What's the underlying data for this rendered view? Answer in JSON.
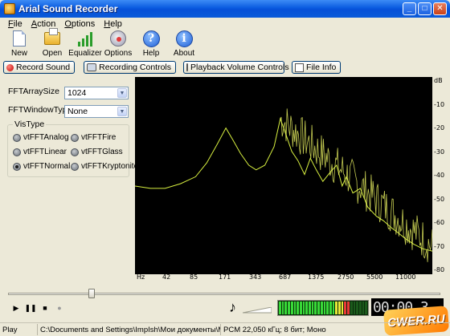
{
  "window": {
    "title": "Arial Sound Recorder",
    "minimize": "_",
    "maximize": "□",
    "close": "✕"
  },
  "menu": [
    "File",
    "Action",
    "Options",
    "Help"
  ],
  "toolbar": [
    {
      "label": "New",
      "icon": "new-file-icon"
    },
    {
      "label": "Open",
      "icon": "open-folder-icon"
    },
    {
      "label": "Equalizer",
      "icon": "equalizer-icon"
    },
    {
      "label": "Options",
      "icon": "options-icon"
    },
    {
      "label": "Help",
      "icon": "help-icon"
    },
    {
      "label": "About",
      "icon": "about-icon"
    }
  ],
  "buttons": {
    "record_sound": "Record Sound",
    "recording_controls": "Recording Controls",
    "playback_volume": "Playback Volume Controls",
    "file_info": "File Info"
  },
  "settings": {
    "fft_array_size_label": "FFTArraySize",
    "fft_array_size_value": "1024",
    "fft_window_type_label": "FFTWindowType",
    "fft_window_type_value": "None",
    "vis_type_label": "VisType",
    "vis_options": [
      {
        "label": "vtFFTAnalog",
        "selected": false
      },
      {
        "label": "vtFFTFire",
        "selected": false
      },
      {
        "label": "vtFFTLinear",
        "selected": false
      },
      {
        "label": "vtFFTGlass",
        "selected": false
      },
      {
        "label": "vtFFTNormal",
        "selected": true
      },
      {
        "label": "vtFFTKryptonite",
        "selected": false
      }
    ]
  },
  "chart_data": {
    "type": "line",
    "xlabel": "Hz",
    "ylabel": "dB",
    "x_ticks": [
      "Hz",
      "42",
      "85",
      "171",
      "343",
      "687",
      "1375",
      "2750",
      "5500",
      "11000"
    ],
    "y_ticks": [
      "dB",
      "-10",
      "-20",
      "-30",
      "-40",
      "-50",
      "-60",
      "-70",
      "-80"
    ],
    "ylim": [
      -85,
      0
    ],
    "series": [
      {
        "color": "#d8f040",
        "x": [
          21,
          30,
          42,
          60,
          85,
          110,
          140,
          171,
          200,
          240,
          290,
          343,
          420,
          520,
          600,
          687,
          780,
          900,
          1050,
          1200,
          1375,
          1600,
          1900,
          2200,
          2500,
          2750,
          3200,
          3800,
          4500,
          5500,
          6500,
          7800,
          9000,
          11000,
          13000,
          16000,
          20000
        ],
        "y": [
          -47,
          -48,
          -48,
          -46,
          -43,
          -37,
          -29,
          -22,
          -27,
          -33,
          -38,
          -40,
          -38,
          -30,
          -18,
          -25,
          -32,
          -36,
          -42,
          -35,
          -40,
          -45,
          -41,
          -38,
          -47,
          -43,
          -50,
          -48,
          -56,
          -60,
          -62,
          -65,
          -67,
          -70,
          -72,
          -74,
          -75
        ]
      }
    ],
    "grid": false
  },
  "transport": {
    "play": "▶",
    "pause": "❚❚",
    "stop": "■",
    "record": "●",
    "volume_icon": "♪"
  },
  "meter_colors": {
    "low": "#38d838",
    "mid": "#e8e838",
    "high": "#e83838",
    "off": "#1b5a1b"
  },
  "timecode": "00:00.3",
  "status": {
    "state": "Play",
    "path": "C:\\Documents and Settings\\ImpIsh\\Мои документы\\МАКСИМ - Г",
    "format": "PCM 22,050 кГц; 8 бит; Моно"
  },
  "watermark": "CWER.RU"
}
